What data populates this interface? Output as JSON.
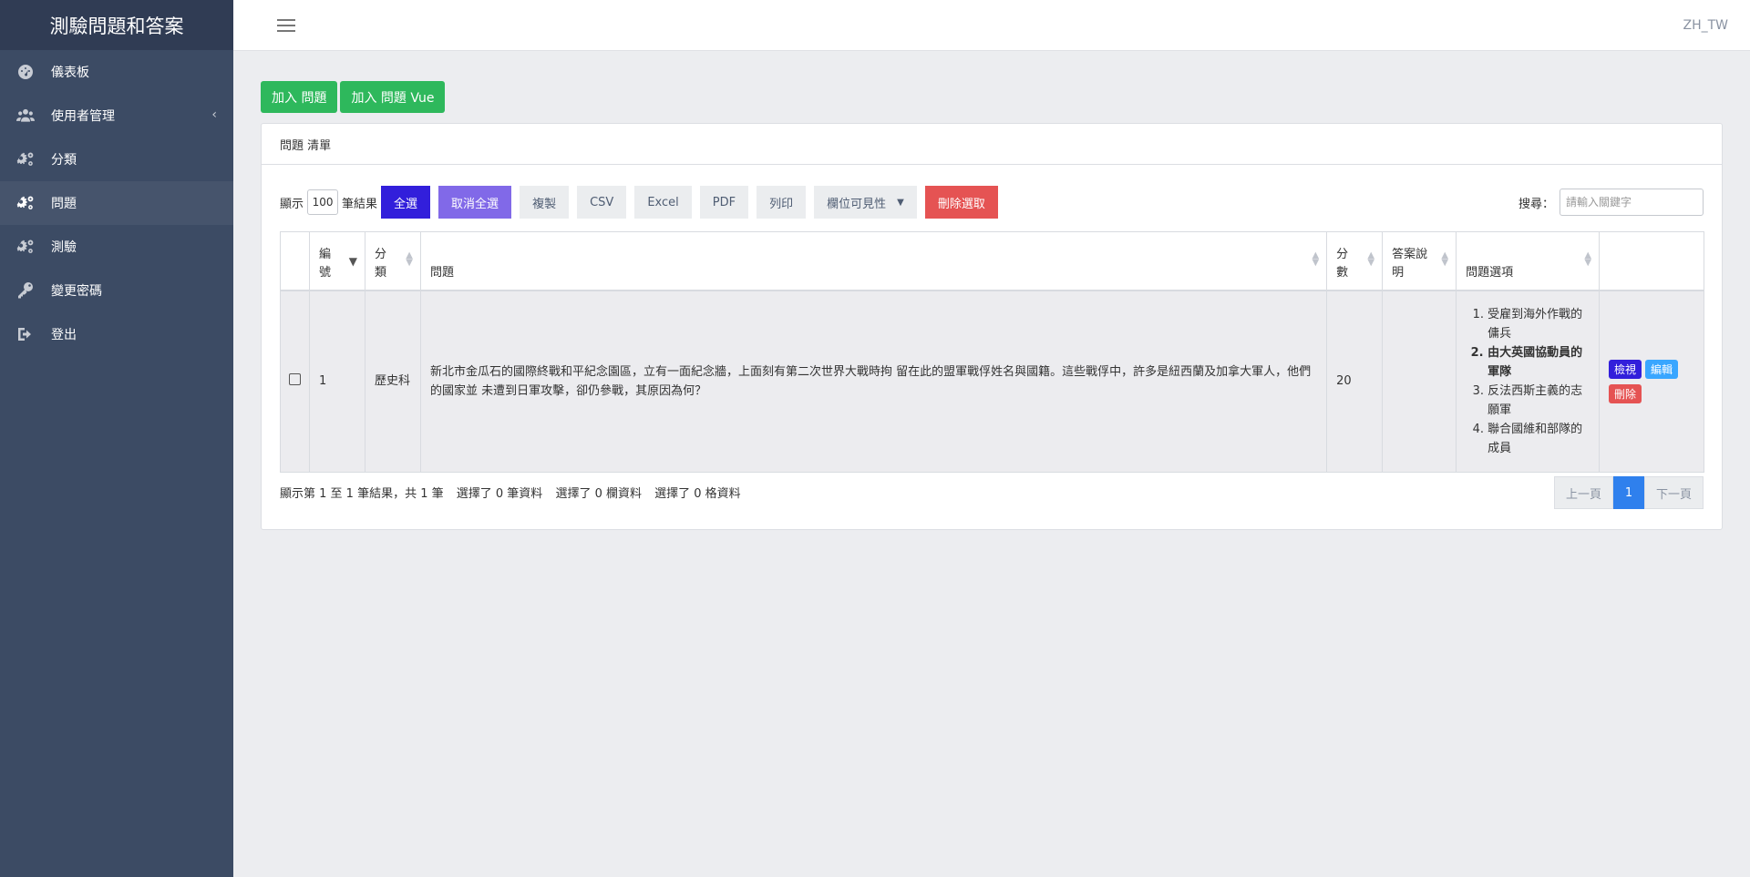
{
  "sidebar": {
    "brand": "測驗問題和答案",
    "items": [
      {
        "label": "儀表板",
        "icon": "dashboard-icon"
      },
      {
        "label": "使用者管理",
        "icon": "users-icon",
        "caret": "‹"
      },
      {
        "label": "分類",
        "icon": "gears-icon"
      },
      {
        "label": "問題",
        "icon": "gears-icon",
        "active": true
      },
      {
        "label": "測驗",
        "icon": "gears-icon"
      },
      {
        "label": "變更密碼",
        "icon": "key-icon"
      },
      {
        "label": "登出",
        "icon": "logout-icon"
      }
    ]
  },
  "header": {
    "locale": "ZH_TW"
  },
  "top_buttons": {
    "add_question": "加入 問題",
    "add_question_vue": "加入 問題 Vue"
  },
  "card": {
    "title": "問題 清單"
  },
  "toolbar": {
    "show_label": "顯示",
    "page_length": "100",
    "entries_label": "筆結果",
    "select_all": "全選",
    "deselect_all": "取消全選",
    "copy": "複製",
    "csv": "CSV",
    "excel": "Excel",
    "pdf": "PDF",
    "print": "列印",
    "column_visibility": "欄位可見性",
    "delete_selected": "刪除選取",
    "search_label": "搜尋：",
    "search_placeholder": "請輸入關鍵字"
  },
  "table": {
    "columns": {
      "id": "編號",
      "category": "分類",
      "question": "問題",
      "score": "分數",
      "explanation": "答案說明",
      "options": "問題選項"
    },
    "rows": [
      {
        "id": "1",
        "category": "歷史科",
        "question": "新北市金瓜石的國際終戰和平紀念園區，立有一面紀念牆，上面刻有第二次世界大戰時拘 留在此的盟軍戰俘姓名與國籍。這些戰俘中，許多是紐西蘭及加拿大軍人，他們的國家並 未遭到日軍攻擊，卻仍參戰，其原因為何？",
        "score": "20",
        "explanation": "",
        "options": [
          "受雇到海外作戰的傭兵",
          "由大英國協動員的軍隊",
          "反法西斯主義的志願軍",
          "聯合國維和部隊的成員"
        ],
        "actions": {
          "view": "檢視",
          "edit": "編輯",
          "delete": "刪除"
        }
      }
    ]
  },
  "footer": {
    "info": "顯示第 1 至 1 筆結果，共 1 筆",
    "sel_rows": "選擇了 0 筆資料",
    "sel_cols": "選擇了 0 欄資料",
    "sel_cells": "選擇了 0 格資料"
  },
  "pagination": {
    "prev": "上一頁",
    "current": "1",
    "next": "下一頁"
  },
  "colors": {
    "sidebar_bg": "#3c4b64",
    "green": "#2eb85c",
    "primary": "#321fdb",
    "danger": "#e55353",
    "info": "#39a6ff"
  }
}
